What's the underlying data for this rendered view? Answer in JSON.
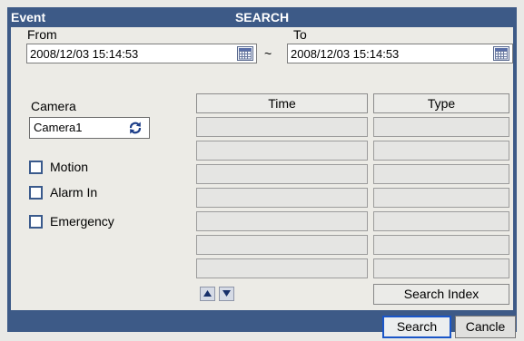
{
  "titlebar": {
    "left_label": "Event",
    "title": "SEARCH"
  },
  "from": {
    "label": "From",
    "value": "2008/12/03  15:14:53"
  },
  "range_separator": "~",
  "to": {
    "label": "To",
    "value": "2008/12/03  15:14:53"
  },
  "camera": {
    "label": "Camera",
    "selected": "Camera1"
  },
  "filters": [
    {
      "label": "Motion",
      "checked": false
    },
    {
      "label": "Alarm In",
      "checked": false
    },
    {
      "label": "Emergency",
      "checked": false
    }
  ],
  "results_table": {
    "columns": [
      "Time",
      "Type"
    ],
    "rows": [
      [
        "",
        ""
      ],
      [
        "",
        ""
      ],
      [
        "",
        ""
      ],
      [
        "",
        ""
      ],
      [
        "",
        ""
      ],
      [
        "",
        ""
      ],
      [
        "",
        ""
      ]
    ]
  },
  "search_index_label": "Search Index",
  "footer": {
    "search_label": "Search",
    "cancel_label": "Cancle"
  },
  "colors": {
    "frame": "#3d5a87",
    "panel": "#ecebe6",
    "primary_border": "#1a56c8"
  },
  "icons": [
    "calendar-icon",
    "cycle-icon",
    "arrow-up-icon",
    "arrow-down-icon"
  ]
}
